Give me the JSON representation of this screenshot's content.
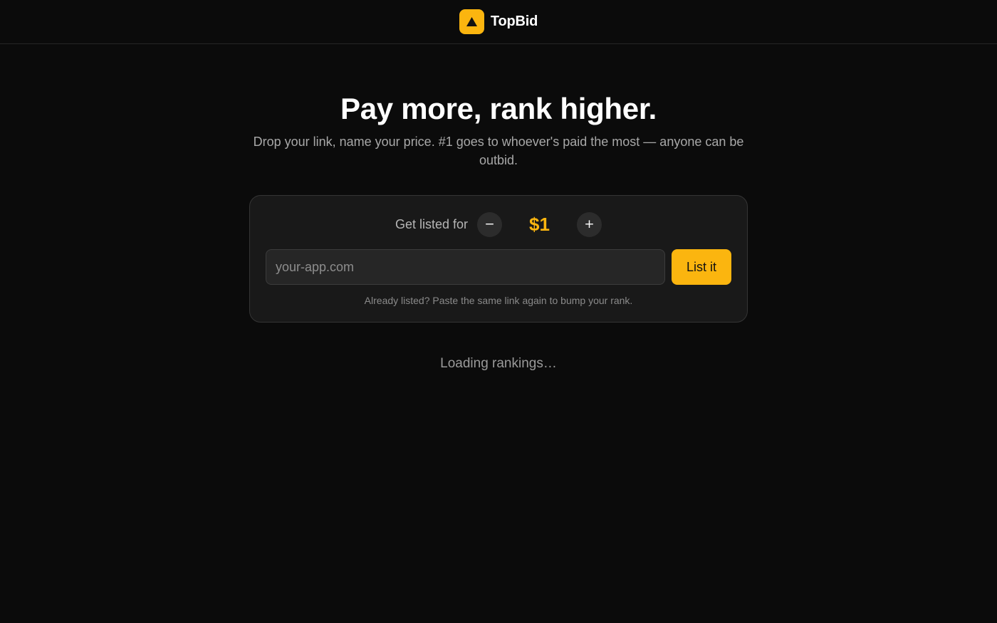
{
  "header": {
    "brand": "TopBid",
    "logo_icon": "triangle-up-icon",
    "accent_color": "#fbb50f"
  },
  "hero": {
    "title": "Pay more, rank higher.",
    "subtitle": "Drop your link, name your price. #1 goes to whoever's paid the most — anyone can be outbid."
  },
  "listing_form": {
    "price_label": "Get listed for",
    "decrement_label": "−",
    "increment_label": "+",
    "price_value": "$1",
    "url_input": {
      "placeholder": "your-app.com",
      "value": ""
    },
    "submit_label": "List it",
    "hint": "Already listed? Paste the same link again to bump your rank."
  },
  "rankings": {
    "status": "Loading rankings…"
  }
}
